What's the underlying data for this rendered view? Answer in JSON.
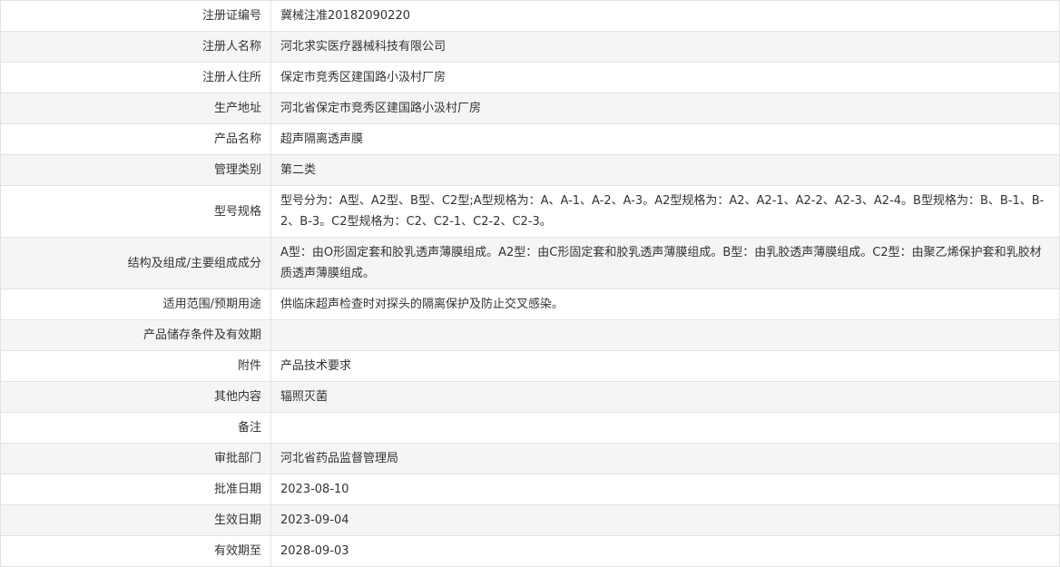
{
  "rows": [
    {
      "label": "注册证编号",
      "value": "冀械注准20182090220"
    },
    {
      "label": "注册人名称",
      "value": "河北求实医疗器械科技有限公司"
    },
    {
      "label": "注册人住所",
      "value": "保定市竞秀区建国路小汲村厂房"
    },
    {
      "label": "生产地址",
      "value": "河北省保定市竞秀区建国路小汲村厂房"
    },
    {
      "label": "产品名称",
      "value": "超声隔离透声膜"
    },
    {
      "label": "管理类别",
      "value": "第二类"
    },
    {
      "label": "型号规格",
      "value": "型号分为：A型、A2型、B型、C2型;A型规格为：A、A-1、A-2、A-3。A2型规格为：A2、A2-1、A2-2、A2-3、A2-4。B型规格为：B、B-1、B-2、B-3。C2型规格为：C2、C2-1、C2-2、C2-3。"
    },
    {
      "label": "结构及组成/主要组成成分",
      "value": "A型：由O形固定套和胶乳透声薄膜组成。A2型：由C形固定套和胶乳透声薄膜组成。B型：由乳胶透声薄膜组成。C2型：由聚乙烯保护套和乳胶材质透声薄膜组成。"
    },
    {
      "label": "适用范围/预期用途",
      "value": "供临床超声检查时对探头的隔离保护及防止交叉感染。"
    },
    {
      "label": "产品储存条件及有效期",
      "value": ""
    },
    {
      "label": "附件",
      "value": "产品技术要求"
    },
    {
      "label": "其他内容",
      "value": "辐照灭菌"
    },
    {
      "label": "备注",
      "value": ""
    },
    {
      "label": "审批部门",
      "value": "河北省药品监督管理局"
    },
    {
      "label": "批准日期",
      "value": "2023-08-10"
    },
    {
      "label": "生效日期",
      "value": "2023-09-04"
    },
    {
      "label": "有效期至",
      "value": "2028-09-03"
    }
  ]
}
